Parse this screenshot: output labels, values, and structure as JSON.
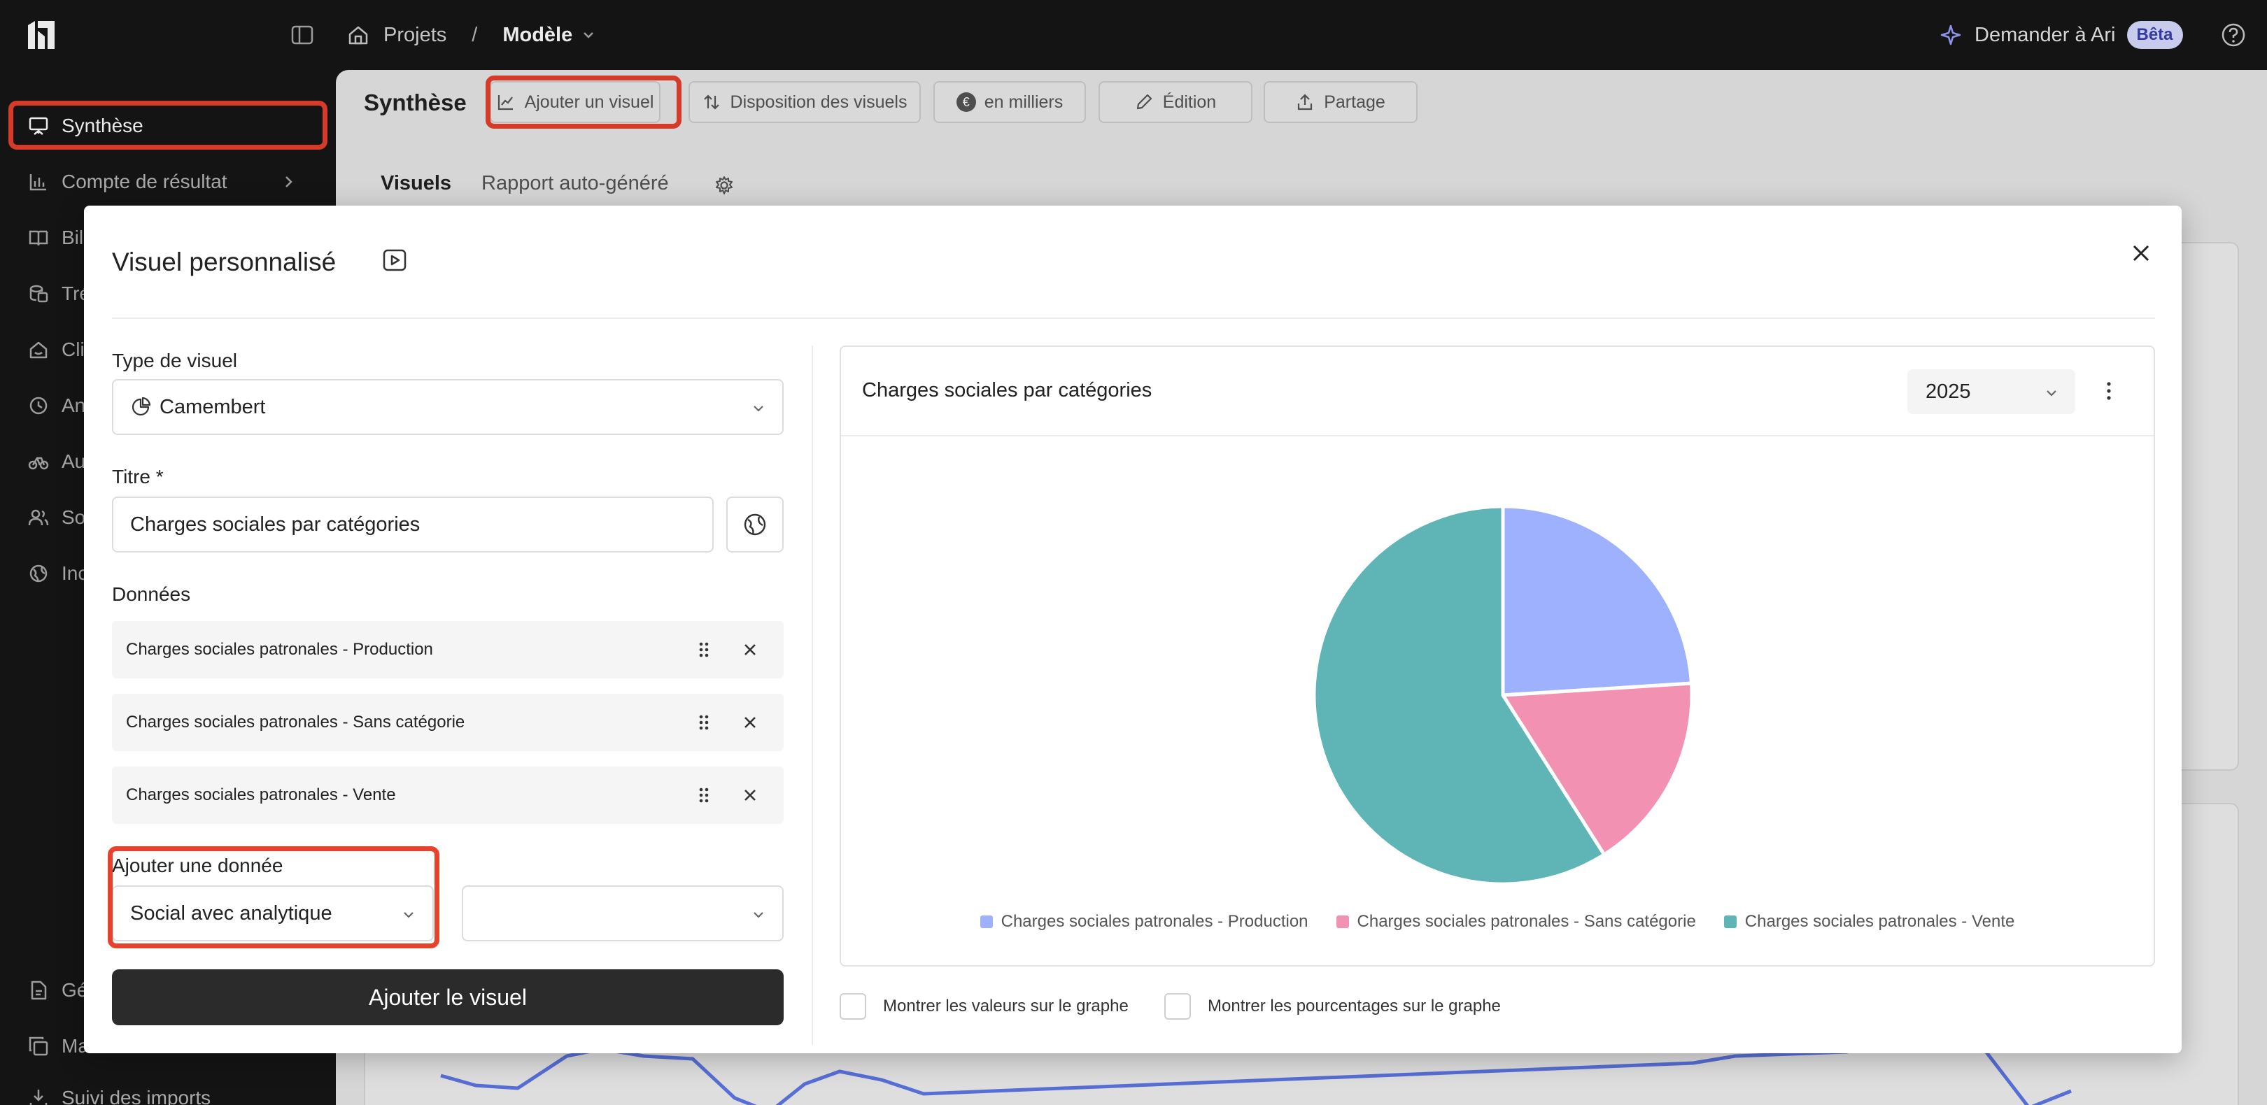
{
  "topbar": {
    "breadcrumb_projects": "Projets",
    "breadcrumb_sep": "/",
    "breadcrumb_current": "Modèle",
    "ask_label": "Demander à Ari",
    "beta_badge": "Bêta"
  },
  "sidebar": {
    "items": [
      {
        "label": "Synthèse",
        "icon": "presentation-icon"
      },
      {
        "label": "Compte de résultat",
        "icon": "bar-chart-icon"
      },
      {
        "label": "Bil",
        "icon": "book-icon"
      },
      {
        "label": "Tré",
        "icon": "coins-icon"
      },
      {
        "label": "Cli",
        "icon": "home-icon"
      },
      {
        "label": "An",
        "icon": "clock-icon"
      },
      {
        "label": "Au",
        "icon": "bicycle-icon"
      },
      {
        "label": "So",
        "icon": "users-icon"
      },
      {
        "label": "Inc",
        "icon": "globe-icon"
      },
      {
        "label": "Gé",
        "icon": "file-icon"
      },
      {
        "label": "Ma",
        "icon": "copy-icon"
      },
      {
        "label": "Suivi des imports",
        "icon": "import-icon"
      }
    ]
  },
  "main": {
    "page_title": "Synthèse",
    "toolbar": {
      "add_visual": "Ajouter un visuel",
      "layout": "Disposition des visuels",
      "currency_symbol": "€",
      "units": "en milliers",
      "edit": "Édition",
      "share": "Partage"
    },
    "tabs": {
      "visuals": "Visuels",
      "auto_report": "Rapport auto-généré"
    }
  },
  "modal": {
    "title": "Visuel personnalisé",
    "type_label": "Type de visuel",
    "type_value": "Camembert",
    "title_label": "Titre *",
    "title_value": "Charges sociales par catégories",
    "data_label": "Données",
    "data_rows": [
      "Charges sociales patronales - Production",
      "Charges sociales patronales - Sans catégorie",
      "Charges sociales patronales - Vente"
    ],
    "add_data_label": "Ajouter une donnée",
    "add_data_value": "Social avec analytique",
    "add_data_secondary": "",
    "add_button": "Ajouter le visuel",
    "preview": {
      "title": "Charges sociales par catégories",
      "year": "2025",
      "show_values": "Montrer les valeurs sur le graphe",
      "show_percentages": "Montrer les pourcentages sur le graphe"
    }
  },
  "colors": {
    "accent_highlight": "#e8412c",
    "production": "#9db1ff",
    "sans_categorie": "#f291b2",
    "vente": "#5fb5b5"
  },
  "chart_data": {
    "type": "pie",
    "title": "Charges sociales par catégories",
    "categories": [
      "Charges sociales patronales - Production",
      "Charges sociales patronales - Sans catégorie",
      "Charges sociales patronales - Vente"
    ],
    "values": [
      24,
      17,
      59
    ],
    "colors": [
      "#9db1ff",
      "#f291b2",
      "#5fb5b5"
    ],
    "legend": "bottom"
  }
}
